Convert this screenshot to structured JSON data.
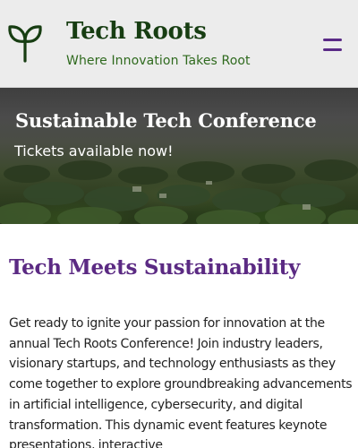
{
  "header": {
    "logo_icon": "sprout-icon",
    "title": "Tech Roots",
    "tagline": "Where Innovation Takes Root",
    "menu_icon": "hamburger-menu-icon",
    "colors": {
      "title": "#173d12",
      "tagline": "#2f6a1e",
      "menu": "#5a2a86"
    }
  },
  "hero": {
    "title": "Sustainable Tech Conference",
    "subtitle": "Tickets available now!"
  },
  "main": {
    "heading": "Tech Meets Sustainability",
    "body": "Get ready to ignite your passion for innovation at the annual Tech Roots Conference! Join industry leaders, visionary startups, and technology enthusiasts as they come together to explore groundbreaking advancements in artificial intelligence, cybersecurity, and digital transformation. This dynamic event features keynote presentations, interactive",
    "colors": {
      "heading": "#5b2a83"
    }
  }
}
